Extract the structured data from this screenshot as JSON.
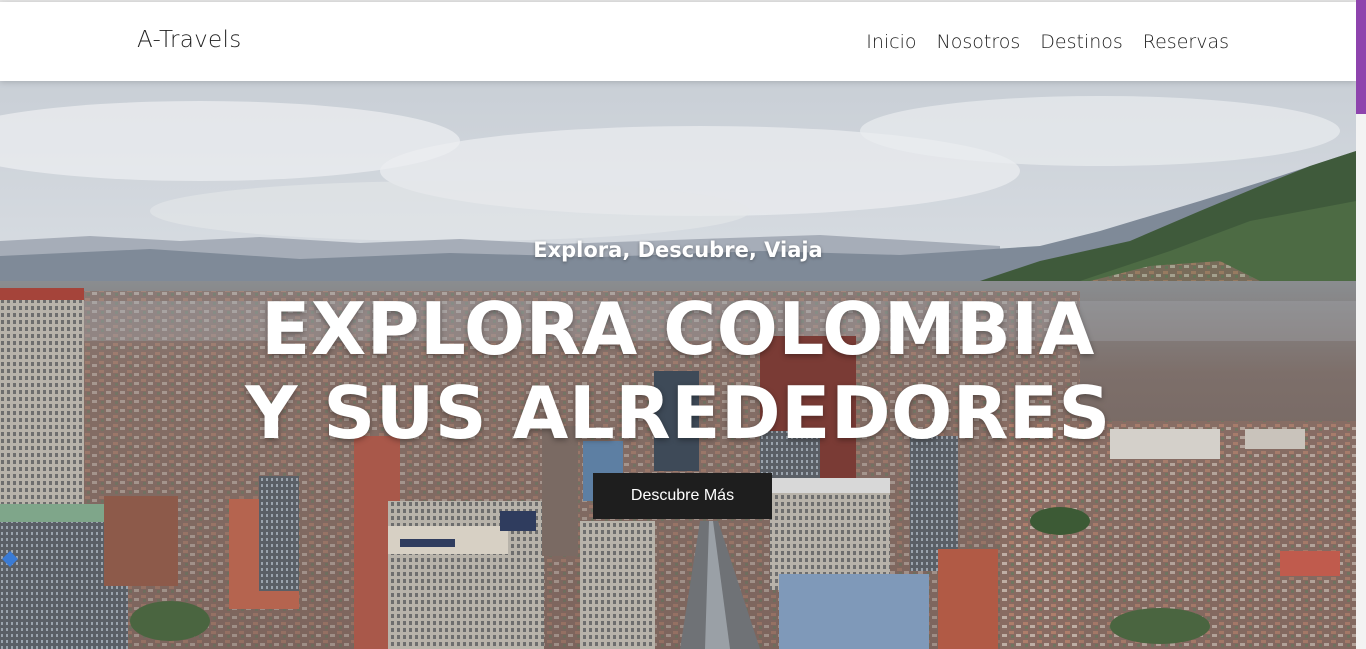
{
  "navbar": {
    "brand": "A-Travels",
    "links": [
      {
        "label": "Inicio"
      },
      {
        "label": "Nosotros"
      },
      {
        "label": "Destinos"
      },
      {
        "label": "Reservas"
      }
    ]
  },
  "hero": {
    "kicker": "Explora, Descubre, Viaja",
    "title_line1": "EXPLORA COLOMBIA",
    "title_line2": "Y SUS ALREDEDORES",
    "button_label": "Descubre Más"
  },
  "colors": {
    "accent": "#8e44ad",
    "button_bg": "#1e1e1e",
    "navbar_bg": "#ffffff"
  }
}
